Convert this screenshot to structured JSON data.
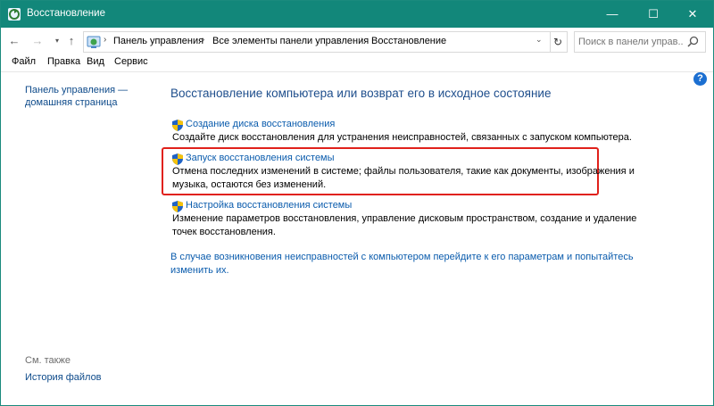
{
  "window": {
    "title": "Восстановление",
    "accent": "#12877a",
    "controls": {
      "minimize": "—",
      "maximize": "☐",
      "close": "✕"
    }
  },
  "address": {
    "crumbs": [
      "Панель управления",
      "Все элементы панели управления",
      "Восстановление"
    ],
    "separator": "›",
    "dropdown_glyph": "⌄",
    "refresh_glyph": "↻",
    "nav": {
      "back": "←",
      "forward": "→",
      "recent": "▾",
      "up": "↑"
    }
  },
  "search": {
    "placeholder": "Поиск в панели управ..."
  },
  "menu": [
    "Файл",
    "Правка",
    "Вид",
    "Сервис"
  ],
  "sidebar": {
    "home_line1": "Панель управления —",
    "home_line2": "домашняя страница",
    "see_also": "См. также",
    "file_history": "История файлов"
  },
  "help_glyph": "?",
  "main": {
    "heading": "Восстановление компьютера или возврат его в исходное состояние",
    "items": [
      {
        "link": "Создание диска восстановления",
        "desc_line1": "Создайте диск восстановления для устранения неисправностей, связанных с запуском компьютера.",
        "desc_line2": ""
      },
      {
        "link": "Запуск восстановления системы",
        "desc_line1": "Отмена последних изменений в системе; файлы пользователя, такие как документы, изображения и",
        "desc_line2": "музыка, остаются без изменений."
      },
      {
        "link": "Настройка восстановления системы",
        "desc_line1": "Изменение параметров восстановления, управление дисковым пространством, создание и удаление",
        "desc_line2": "точек восстановления."
      }
    ],
    "note_line1": "В случае возникновения неисправностей с компьютером перейдите к его параметрам и попытайтесь",
    "note_line2": "изменить их."
  },
  "colors": {
    "link": "#0b5cad",
    "heading": "#1e4e8c",
    "highlight": "#e0211b"
  }
}
